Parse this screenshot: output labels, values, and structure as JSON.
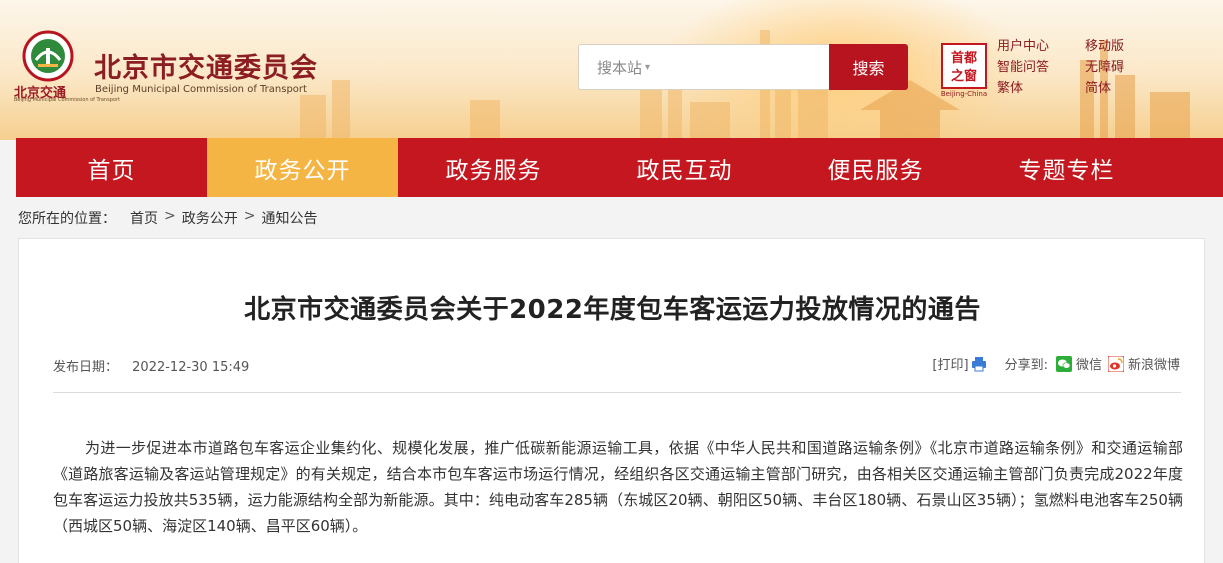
{
  "header": {
    "logo_cn": "北京交通",
    "logo_en": "Beijing Municipal Commission of Transport",
    "site_title": "北京市交通委员会",
    "site_subtitle": "Beijing Municipal Commission of Transport",
    "search_placeholder": "搜本站",
    "search_button": "搜索",
    "seal_text": "首都之窗",
    "seal_sub": "Beijing-China",
    "links_col1": [
      "用户中心",
      "智能问答",
      "繁体"
    ],
    "links_col2": [
      "移动版",
      "无障碍",
      "简体"
    ]
  },
  "nav": {
    "items": [
      "首页",
      "政务公开",
      "政务服务",
      "政民互动",
      "便民服务",
      "专题专栏"
    ],
    "active_index": 1
  },
  "breadcrumb": {
    "label": "您所在的位置：",
    "items": [
      "首页",
      "政务公开",
      "通知公告"
    ],
    "separator": ">"
  },
  "article": {
    "title": "北京市交通委员会关于2022年度包车客运运力投放情况的通告",
    "date_label": "发布日期：",
    "date": "2022-12-30 15:49",
    "print_label": "[打印]",
    "share_label": "分享到:",
    "share_wechat": "微信",
    "share_weibo": "新浪微博",
    "body": "为进一步促进本市道路包车客运企业集约化、规模化发展，推广低碳新能源运输工具，依据《中华人民共和国道路运输条例》《北京市道路运输条例》和交通运输部《道路旅客运输及客运站管理规定》的有关规定，结合本市包车客运市场运行情况，经组织各区交通运输主管部门研究，由各相关区交通运输主管部门负责完成2022年度包车客运运力投放共535辆，运力能源结构全部为新能源。其中：纯电动客车285辆（东城区20辆、朝阳区50辆、丰台区180辆、石景山区35辆）；氢燃料电池客车250辆（西城区50辆、海淀区140辆、昌平区60辆）。"
  },
  "colors": {
    "brand_red": "#c4171f",
    "active_tab": "#f5b544",
    "title_red": "#8c1d22"
  }
}
